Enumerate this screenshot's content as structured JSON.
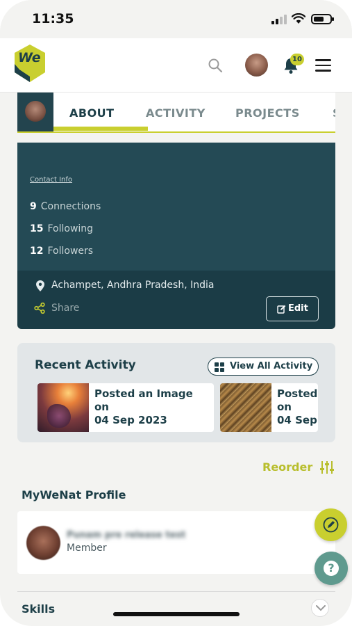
{
  "status_bar": {
    "time": "11:35"
  },
  "header": {
    "logo_text": "We",
    "notification_count": "10"
  },
  "profile": {
    "tabs": [
      {
        "label": "ABOUT",
        "active": true
      },
      {
        "label": "ACTIVITY",
        "active": false
      },
      {
        "label": "PROJECTS",
        "active": false
      },
      {
        "label": "S",
        "active": false
      }
    ],
    "contact_info": "Contact Info",
    "stats": [
      {
        "count": "9",
        "label": "Connections"
      },
      {
        "count": "15",
        "label": "Following"
      },
      {
        "count": "12",
        "label": "Followers"
      }
    ],
    "location": "Achampet, Andhra Pradesh, India",
    "share_label": "Share",
    "edit_label": "Edit"
  },
  "recent_activity": {
    "title": "Recent Activity",
    "view_all_label": "View All Activity",
    "items": [
      {
        "line1": "Posted an Image",
        "line2": "on",
        "line3": "04 Sep 2023"
      },
      {
        "line1": "Posted",
        "line2": "on",
        "line3": "04 Sep"
      }
    ]
  },
  "reorder_label": "Reorder",
  "mywenat": {
    "title": "MyWeNat Profile",
    "name": "Punam pre release test",
    "role": "Member"
  },
  "skills_title": "Skills",
  "colors": {
    "brand_dark": "#1d3f48",
    "brand_lime": "#c9cf2f",
    "panel": "#244a55"
  }
}
